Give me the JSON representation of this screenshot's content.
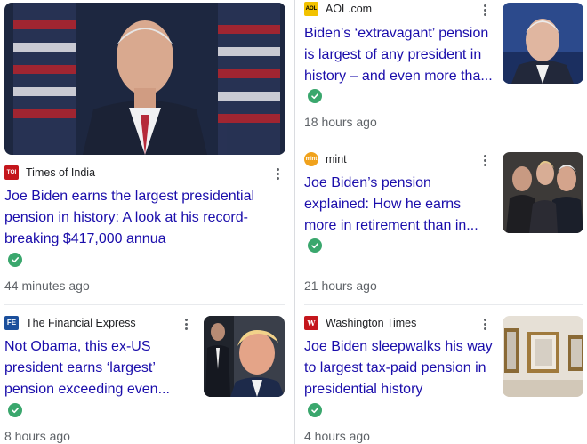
{
  "articles": [
    {
      "source": "Times of India",
      "logo_text": "TOI",
      "headline": "Joe Biden earns the largest presidential pension in history: A look at his record-breaking $417,000 annua",
      "time": "44 minutes ago",
      "verified": true
    },
    {
      "source": "AOL.com",
      "logo_text": "AOL",
      "headline": "Biden’s ‘extravagant’ pension is largest of any president in history – and even more tha...",
      "time": "18 hours ago",
      "verified": true
    },
    {
      "source": "mint",
      "logo_text": "mint",
      "headline": "Joe Biden’s pension explained: How he earns more in retirement than in...",
      "time": "21 hours ago",
      "verified": true
    },
    {
      "source": "The Financial Express",
      "logo_text": "FE",
      "headline": "Not Obama, this ex-US president earns ‘largest’ pension exceeding even...",
      "time": "8 hours ago",
      "verified": true
    },
    {
      "source": "Washington Times",
      "logo_text": "W",
      "headline": "Joe Biden sleepwalks his way to largest tax-paid pension in presidential history",
      "time": "4 hours ago",
      "verified": true
    }
  ],
  "colors": {
    "link": "#1a0dab",
    "verified": "#3aa76d",
    "muted": "#5f6368"
  },
  "icons": {
    "menu": "more-vert-icon",
    "verified": "check-circle-icon"
  }
}
